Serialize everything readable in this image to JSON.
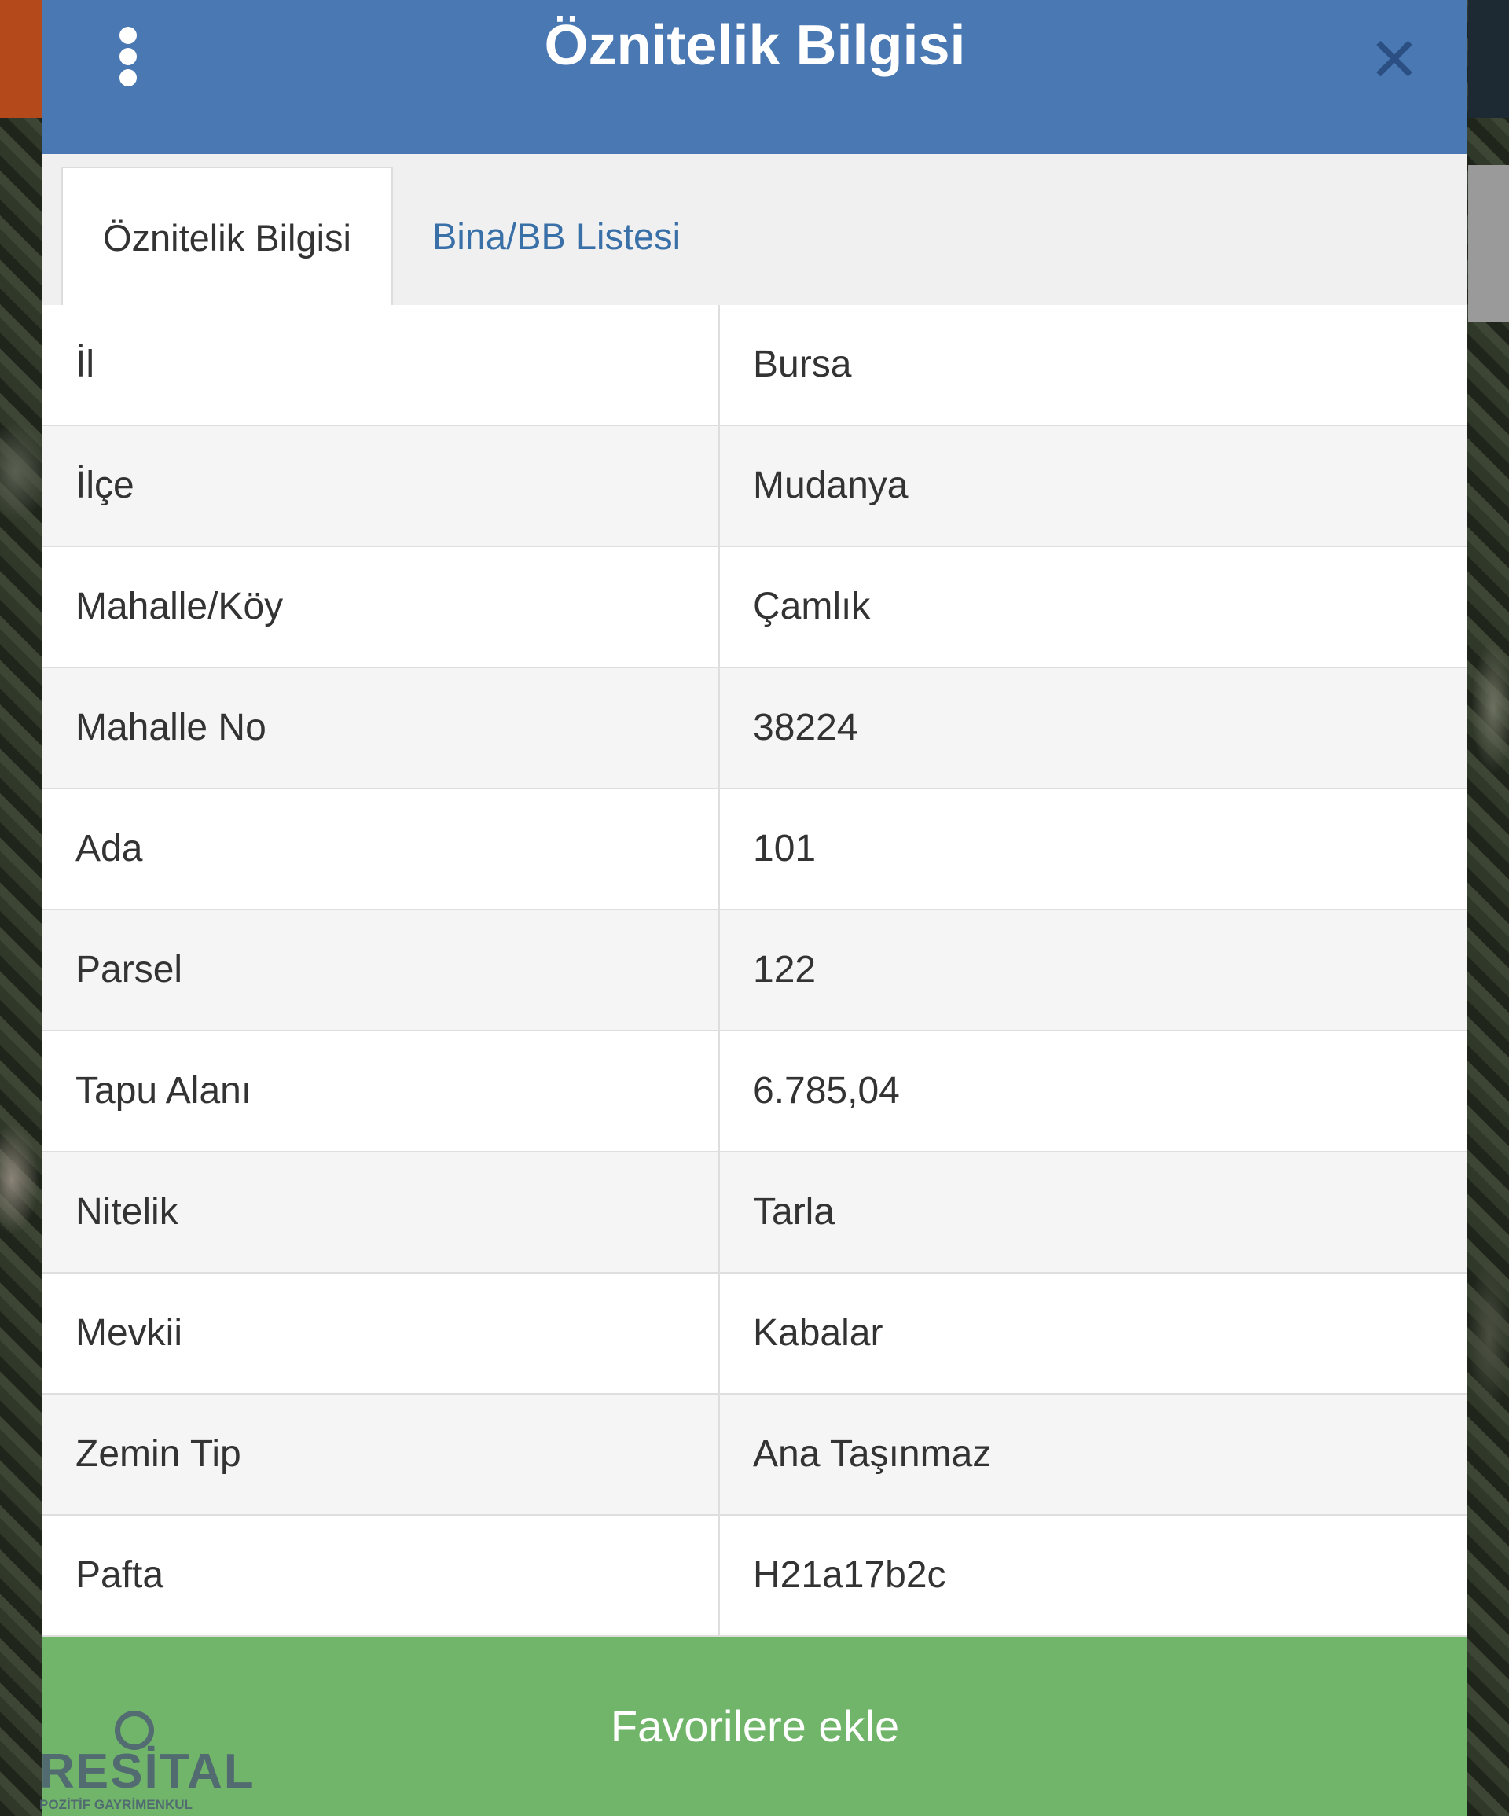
{
  "header": {
    "title": "Öznitelik Bilgisi",
    "menu_icon": "kebab-menu-icon",
    "close_icon": "close-icon"
  },
  "tabs": [
    {
      "label": "Öznitelik Bilgisi",
      "active": true
    },
    {
      "label": "Bina/BB Listesi",
      "active": false
    }
  ],
  "attributes": [
    {
      "key": "İl",
      "value": "Bursa"
    },
    {
      "key": "İlçe",
      "value": "Mudanya"
    },
    {
      "key": "Mahalle/Köy",
      "value": "Çamlık"
    },
    {
      "key": "Mahalle No",
      "value": "38224"
    },
    {
      "key": "Ada",
      "value": "101"
    },
    {
      "key": "Parsel",
      "value": "122"
    },
    {
      "key": "Tapu Alanı",
      "value": "6.785,04"
    },
    {
      "key": "Nitelik",
      "value": "Tarla"
    },
    {
      "key": "Mevkii",
      "value": "Kabalar"
    },
    {
      "key": "Zemin Tip",
      "value": "Ana Taşınmaz"
    },
    {
      "key": "Pafta",
      "value": "H21a17b2c"
    }
  ],
  "footer": {
    "favorite_label": "Favorilere ekle"
  },
  "watermark": {
    "logo_text": "RESİTAL",
    "subtitle": "POZİTİF GAYRİMENKUL"
  },
  "colors": {
    "header": "#4a78b3",
    "tab_link": "#3a70a8",
    "favorite_button": "#71b56a"
  }
}
